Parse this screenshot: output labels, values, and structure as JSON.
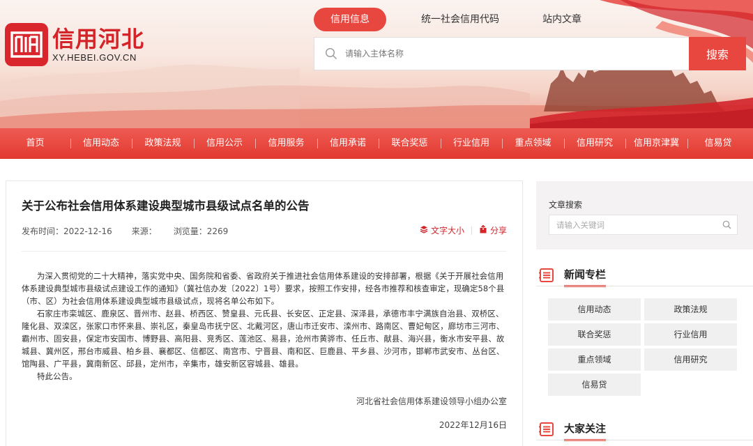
{
  "brand": {
    "title": "信用河北",
    "url": "XY.HEBEI.GOV.CN"
  },
  "search": {
    "tabs": [
      "信用信息",
      "统一社会信用代码",
      "站内文章"
    ],
    "placeholder": "请输入主体名称",
    "button": "搜索"
  },
  "nav": [
    "首页",
    "信用动态",
    "政策法规",
    "信用公示",
    "信用服务",
    "信用承诺",
    "联合奖惩",
    "行业信用",
    "重点领域",
    "信用研究",
    "信用京津冀",
    "信易贷"
  ],
  "article": {
    "title": "关于公布社会信用体系建设典型城市县级试点名单的公告",
    "publish": "发布时间：2022-12-16",
    "source": "来源：",
    "views": "浏览量：2269",
    "font_size": "文字大小",
    "share": "分享",
    "para1": "为深入贯彻党的二十大精神，落实党中央、国务院和省委、省政府关于推进社会信用体系建设的安排部署，根据《关于开展社会信用体系建设典型城市县级试点建设工作的通知》（冀社信办发〔2022〕1号）要求，按照工作安排，经各市推荐和核查审定，现确定58个县（市、区）为社会信用体系建设典型城市县级试点，现将名单公布如下。",
    "para2": "石家庄市栾城区、鹿泉区、晋州市、赵县、桥西区、赞皇县、元氏县、长安区、正定县、深泽县，承德市丰宁满族自治县、双桥区、隆化县、双滦区，张家口市怀来县、崇礼区，秦皇岛市抚宁区、北戴河区，唐山市迁安市、滦州市、路南区、曹妃甸区，廊坊市三河市、霸州市、固安县，保定市安国市、博野县、高阳县、竞秀区、莲池区、易县，沧州市黄骅市、任丘市、献县、海兴县，衡水市安平县、故城县、冀州区，邢台市威县、柏乡县、襄都区、信都区、南宫市、宁晋县、南和区、巨鹿县、平乡县、沙河市，邯郸市武安市、丛台区、馆陶县、广平县，冀南新区、邱县，定州市，辛集市，雄安新区容城县、雄县。",
    "para3": "特此公告。",
    "signature": "河北省社会信用体系建设领导小组办公室",
    "date": "2022年12月16日"
  },
  "sidebar": {
    "search_label": "文章搜索",
    "search_placeholder": "请输入关键词",
    "news_title": "新闻专栏",
    "news_tags": [
      "信用动态",
      "政策法规",
      "联合奖惩",
      "行业信用",
      "重点领域",
      "信用研究",
      "信易贷"
    ],
    "focus_title": "大家关注"
  },
  "colors": {
    "brand_red": "#e8473f",
    "logo_red": "#d3242a"
  }
}
